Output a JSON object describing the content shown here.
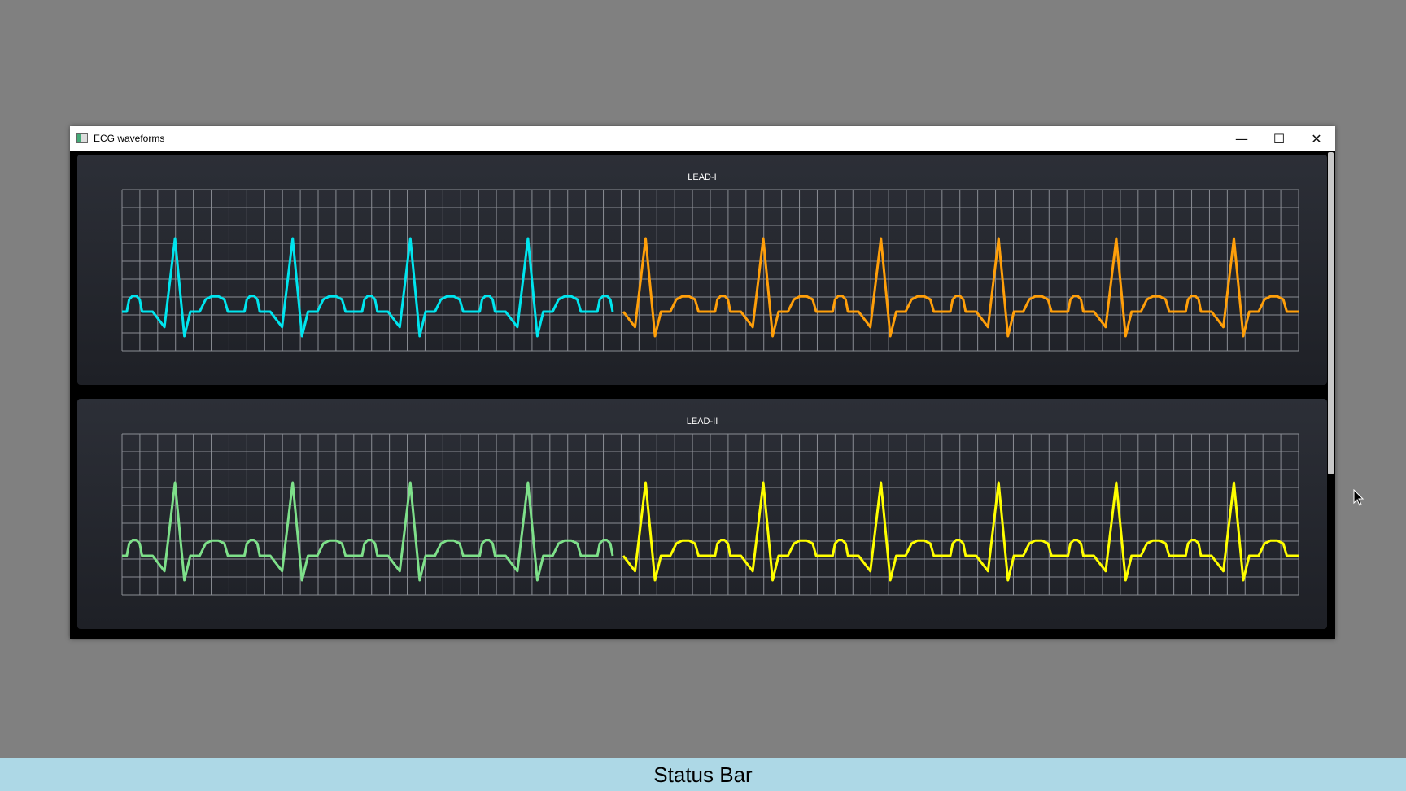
{
  "window": {
    "title": "ECG waveforms",
    "controls": {
      "minimize": "—",
      "maximize": "☐",
      "close": "✕"
    }
  },
  "panels": [
    {
      "title": "LEAD-I",
      "old_color": "#00e5ee",
      "new_color": "#ff9f0a"
    },
    {
      "title": "LEAD-II",
      "old_color": "#7ee08a",
      "new_color": "#ffff00"
    }
  ],
  "chart_data": [
    {
      "type": "line",
      "title": "LEAD-I",
      "grid": true,
      "beats_visible": 10,
      "sweep_split_beat": 4.2,
      "series": [
        {
          "name": "",
          "color": "#00e5ee",
          "beats": [
            0,
            4.2
          ]
        },
        {
          "name": "",
          "color": "#ff9f0a",
          "beats": [
            4.2,
            10
          ]
        }
      ]
    },
    {
      "type": "line",
      "title": "LEAD-II",
      "grid": true,
      "beats_visible": 10,
      "sweep_split_beat": 4.2,
      "series": [
        {
          "name": "",
          "color": "#7ee08a",
          "beats": [
            0,
            4.2
          ]
        },
        {
          "name": "",
          "color": "#ffff00",
          "beats": [
            4.2,
            10
          ]
        }
      ]
    }
  ],
  "status_bar": {
    "text": "Status Bar"
  },
  "icons": [
    "app-icon",
    "minimize-icon",
    "maximize-icon",
    "close-icon",
    "cursor-icon"
  ]
}
